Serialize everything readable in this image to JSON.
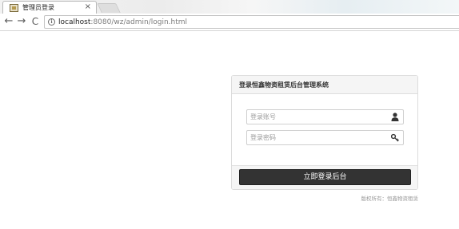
{
  "browser": {
    "tab_title": "管理员登录",
    "tab_close": "×",
    "url_host": "localhost",
    "url_path": ":8080/wz/admin/login.html",
    "back_glyph": "←",
    "forward_glyph": "→",
    "reload_glyph": "C",
    "info_glyph": "i"
  },
  "login": {
    "title": "登录恒鑫物资租赁后台管理系统",
    "username_placeholder": "登录账号",
    "username_value": "",
    "password_placeholder": "登录密码",
    "password_value": "",
    "submit_label": "立即登录后台",
    "copyright": "版权所有：恒鑫物资租赁"
  },
  "icons": {
    "favicon": "page-favicon",
    "user": "user-icon",
    "key": "key-icon"
  },
  "colors": {
    "button_bg": "#333333",
    "panel_header_bg": "#f5f5f5",
    "border": "#dcdcdc"
  }
}
